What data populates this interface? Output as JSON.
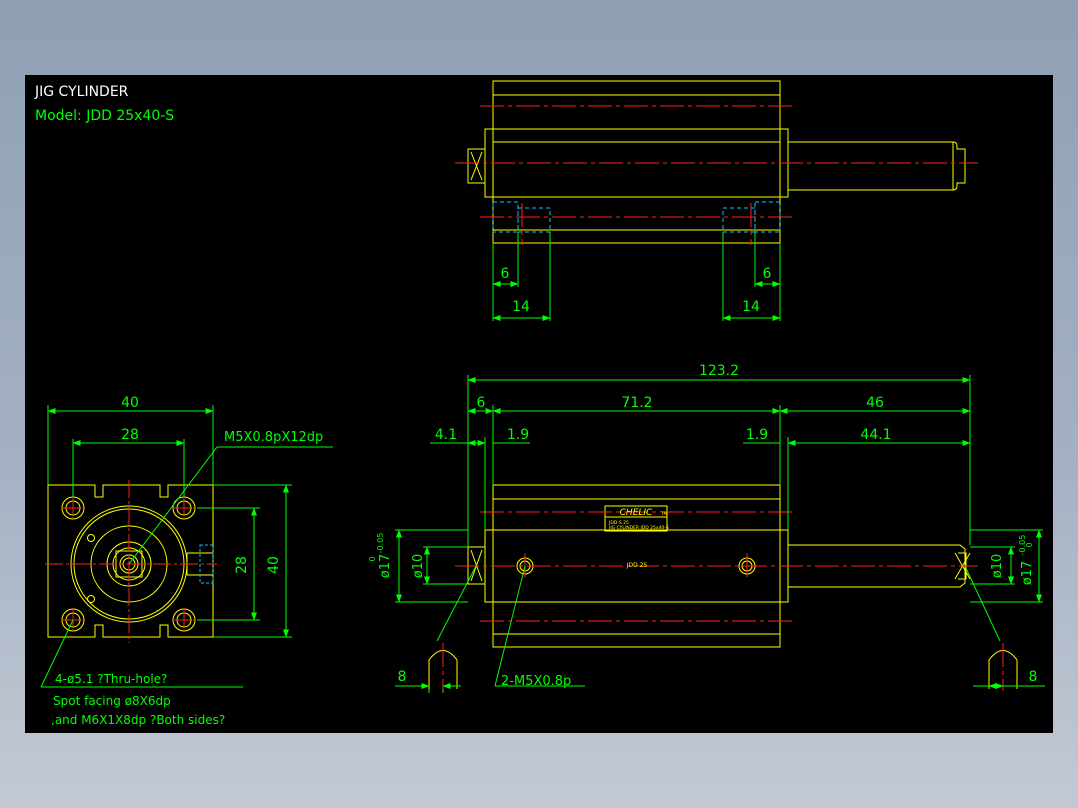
{
  "title": {
    "heading": "JIG CYLINDER",
    "model": "Model:  JDD 25x40-S"
  },
  "colors": {
    "background": "#000000",
    "outline": "#ffff00",
    "dimension": "#00ff00",
    "centerline": "#ff2020",
    "hidden": "#00c8ff",
    "title": "#ffffff",
    "model": "#00ff00"
  },
  "top_view": {
    "dim_left_inner": "6",
    "dim_left_outer": "14",
    "dim_right_inner": "6",
    "dim_right_outer": "14"
  },
  "end_view": {
    "dim_width_outer": "40",
    "dim_width_inner": "28",
    "dim_height_inner": "28",
    "dim_height_outer": "40",
    "thread_callout": "M5X0.8pX12dp",
    "hole_note_1": "4-ø5.1 ?Thru-hole?",
    "hole_note_2": "Spot facing  ø8X6dp",
    "hole_note_3": ",and M6X1X8dp ?Both sides?"
  },
  "side_view": {
    "dim_total": "123.2",
    "dim_6": "6",
    "dim_body": "71.2",
    "dim_rod": "46",
    "dim_4_1": "4.1",
    "dim_1_9_left": "1.9",
    "dim_1_9_right": "1.9",
    "dim_44_1": "44.1",
    "dia10_left": "ø10",
    "dia17_left": "ø17",
    "tol_left_upper": "0",
    "tol_left_lower": "-0.05",
    "dia10_right": "ø10",
    "dia17_right": "ø17",
    "tol_right_upper": "0",
    "tol_right_lower": "-0.05",
    "dim_8_left": "8",
    "dim_8_right": "8",
    "port_callout": "2-M5X0.8p",
    "label_brand": "CHELIC",
    "label_mark": "TM",
    "label_model": "JDD-S 25",
    "label_line": "JIG CYLINDER  JDD 25x40-S",
    "body_mark": "JDD 25"
  }
}
